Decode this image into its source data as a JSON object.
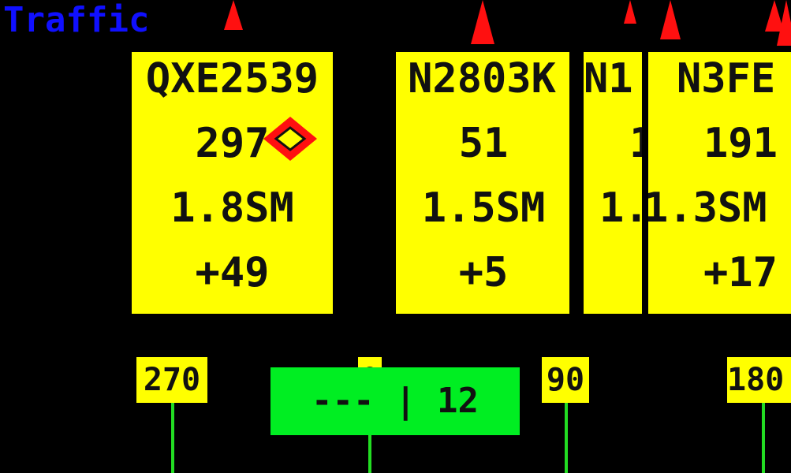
{
  "title": "Traffic",
  "colors": {
    "background": "#000000",
    "title": "#1010ff",
    "card": "#ffff00",
    "marker": "#ff1010",
    "status_box": "#00ee22",
    "tick": "#22dd22"
  },
  "traffic_cards": [
    {
      "callsign": "QXE2539",
      "bearing": "297",
      "distance": "1.8SM",
      "altitude": "+49"
    },
    {
      "callsign": "N2803K",
      "bearing": "51",
      "distance": "1.5SM",
      "altitude": "+5"
    },
    {
      "callsign": "N1",
      "bearing": "1",
      "distance": "1.",
      "altitude": ""
    },
    {
      "callsign": "N3FE",
      "bearing": "191",
      "distance": "1.3SM",
      "altitude": "+17"
    }
  ],
  "heading_scale": {
    "labels": [
      "270",
      "0",
      "90",
      "180"
    ]
  },
  "status": {
    "text": "--- | 12"
  },
  "icons": {
    "ownship": "diamond-marker-icon",
    "traffic": "traffic-triangle-icon"
  }
}
